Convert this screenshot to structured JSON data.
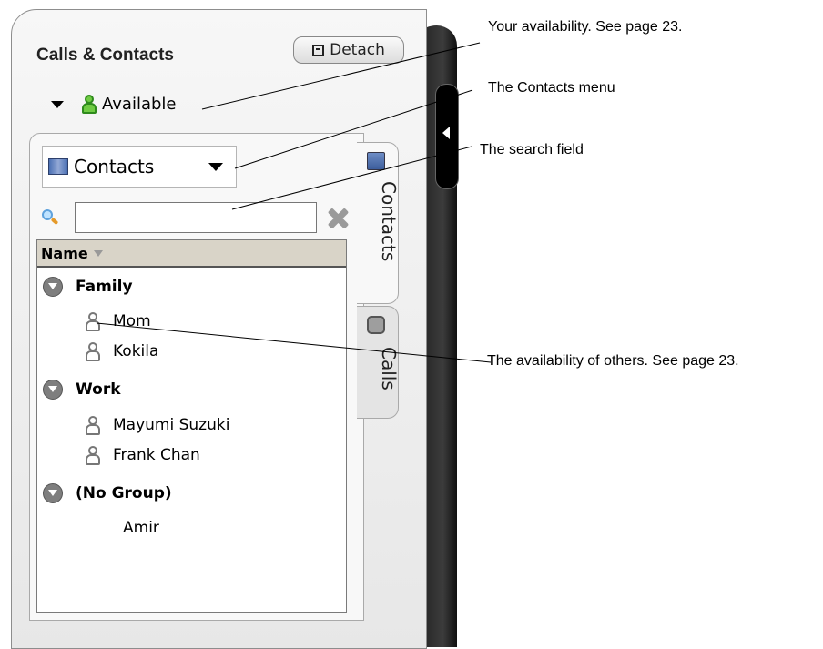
{
  "window": {
    "title": "Calls & Contacts",
    "detach_label": "Detach"
  },
  "availability": {
    "status": "Available",
    "status_color": "#6fcb43"
  },
  "contacts_menu": {
    "label": "Contacts"
  },
  "search": {
    "value": "",
    "placeholder": ""
  },
  "list": {
    "column_header": "Name",
    "groups": [
      {
        "name": "Family",
        "contacts": [
          "Mom",
          "Kokila"
        ]
      },
      {
        "name": "Work",
        "contacts": [
          "Mayumi Suzuki",
          "Frank Chan"
        ]
      },
      {
        "name": "(No Group)",
        "contacts": [
          "Amir"
        ]
      }
    ]
  },
  "tabs": {
    "contacts": "Contacts",
    "calls": "Calls"
  },
  "callouts": {
    "availability": "Your availability. See page 23.",
    "contacts_menu": "The Contacts menu",
    "search_field": "The search field",
    "others_availability": "The availability of others. See page 23."
  }
}
